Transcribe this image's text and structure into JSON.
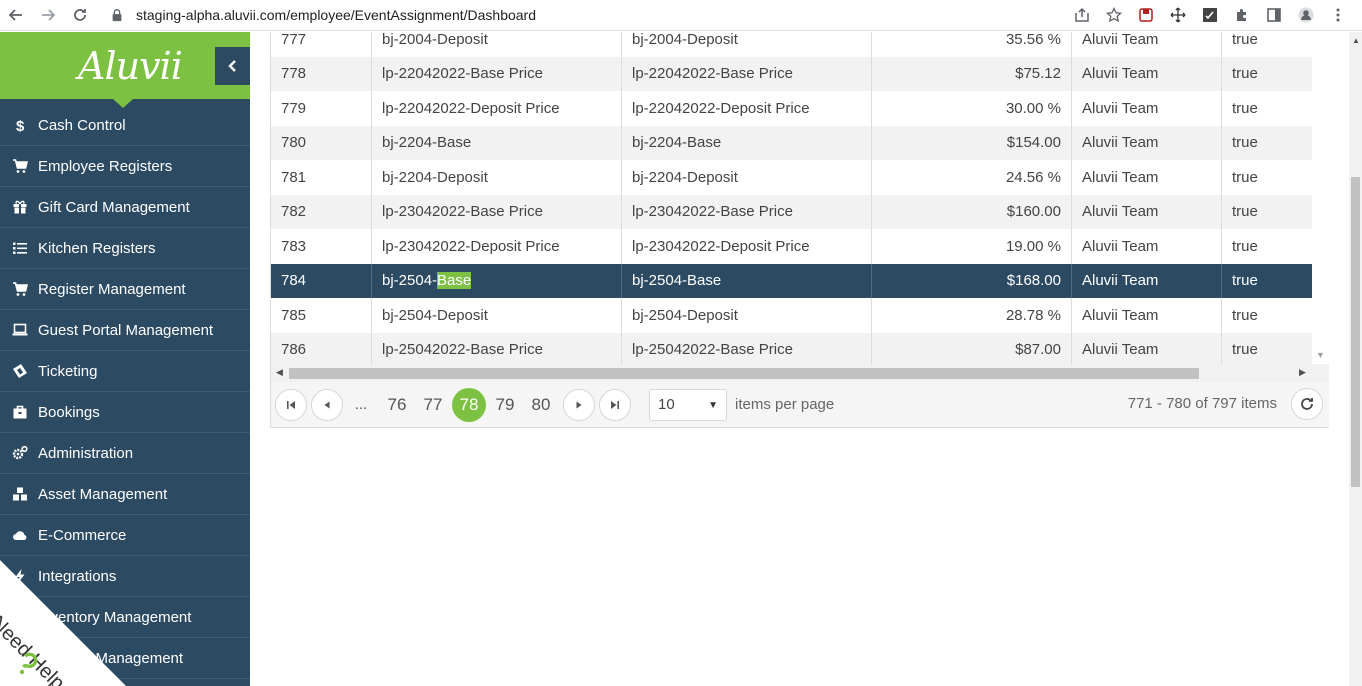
{
  "browser": {
    "url": "staging-alpha.aluvii.com/employee/EventAssignment/Dashboard"
  },
  "brand": {
    "logo_text": "Aluvii",
    "accent": "#7cc142",
    "sidebar_bg": "#2d4a63"
  },
  "sidebar": {
    "items": [
      {
        "label": "Cash Control",
        "icon": "dollar-icon"
      },
      {
        "label": "Employee Registers",
        "icon": "cart-icon"
      },
      {
        "label": "Gift Card Management",
        "icon": "gift-icon"
      },
      {
        "label": "Kitchen Registers",
        "icon": "list-icon"
      },
      {
        "label": "Register Management",
        "icon": "cart-icon"
      },
      {
        "label": "Guest Portal Management",
        "icon": "laptop-icon"
      },
      {
        "label": "Ticketing",
        "icon": "ticket-icon"
      },
      {
        "label": "Bookings",
        "icon": "briefcase-icon"
      },
      {
        "label": "Administration",
        "icon": "gears-icon"
      },
      {
        "label": "Asset Management",
        "icon": "cubes-icon"
      },
      {
        "label": "E-Commerce",
        "icon": "cloud-icon"
      },
      {
        "label": "Integrations",
        "icon": "bolt-icon"
      },
      {
        "label": "Inventory Management",
        "icon": "box-icon"
      },
      {
        "label": "l Management",
        "icon": "folder-icon"
      }
    ],
    "need_help": "Need Help"
  },
  "grid": {
    "rows": [
      {
        "id": "777",
        "name": "bj-2004-Deposit",
        "desc": "bj-2004-Deposit",
        "value": "35.56 %",
        "team": "Aluvii Team",
        "flag": "true"
      },
      {
        "id": "778",
        "name": "lp-22042022-Base Price",
        "desc": "lp-22042022-Base Price",
        "value": "$75.12",
        "team": "Aluvii Team",
        "flag": "true"
      },
      {
        "id": "779",
        "name": "lp-22042022-Deposit Price",
        "desc": "lp-22042022-Deposit Price",
        "value": "30.00 %",
        "team": "Aluvii Team",
        "flag": "true"
      },
      {
        "id": "780",
        "name": "bj-2204-Base",
        "desc": "bj-2204-Base",
        "value": "$154.00",
        "team": "Aluvii Team",
        "flag": "true"
      },
      {
        "id": "781",
        "name": "bj-2204-Deposit",
        "desc": "bj-2204-Deposit",
        "value": "24.56 %",
        "team": "Aluvii Team",
        "flag": "true"
      },
      {
        "id": "782",
        "name": "lp-23042022-Base Price",
        "desc": "lp-23042022-Base Price",
        "value": "$160.00",
        "team": "Aluvii Team",
        "flag": "true"
      },
      {
        "id": "783",
        "name": "lp-23042022-Deposit Price",
        "desc": "lp-23042022-Deposit Price",
        "value": "19.00 %",
        "team": "Aluvii Team",
        "flag": "true"
      },
      {
        "id": "784",
        "name_prefix": "bj-2504-",
        "name_highlight": "Base",
        "desc": "bj-2504-Base",
        "value": "$168.00",
        "team": "Aluvii Team",
        "flag": "true"
      },
      {
        "id": "785",
        "name": "bj-2504-Deposit",
        "desc": "bj-2504-Deposit",
        "value": "28.78 %",
        "team": "Aluvii Team",
        "flag": "true"
      },
      {
        "id": "786",
        "name": "lp-25042022-Base Price",
        "desc": "lp-25042022-Base Price",
        "value": "$87.00",
        "team": "Aluvii Team",
        "flag": "true"
      }
    ]
  },
  "pager": {
    "ellipsis": "...",
    "pages": [
      "76",
      "77",
      "78",
      "79",
      "80"
    ],
    "current": "78",
    "page_size": "10",
    "items_per_page_label": "items per page",
    "info": "771 - 780 of 797 items"
  }
}
